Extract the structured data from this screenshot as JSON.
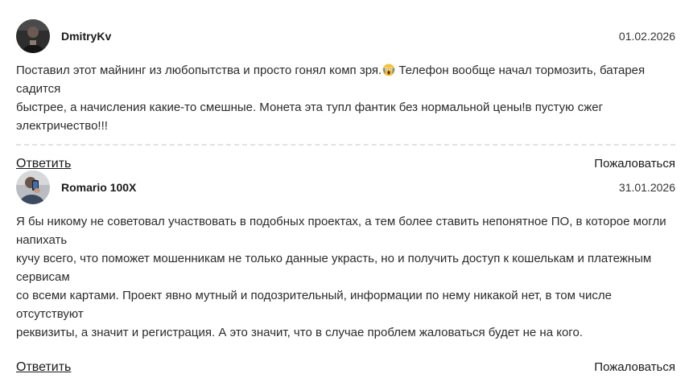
{
  "comments": [
    {
      "author": "DmitryKv",
      "date": "01.02.2026",
      "text_before_emoji": "Поставил этот майнинг из любопытства и просто гонял комп зря.",
      "emoji": "face-screaming-in-fear",
      "text_after_emoji": " Телефон вообще начал тормозить, батарея садится\nбыстрее, а начисления какие-то смешные. Монета эта тупл фантик без нормальной цены!в пустую сжег электричество!!!",
      "reply_label": "Ответить",
      "report_label": "Пожаловаться"
    },
    {
      "author": "Romario 100X",
      "date": "31.01.2026",
      "text": "Я бы никому не советовал участвовать в подобных проектах, а тем более ставить непонятное ПО, в которое могли напихать\nкучу всего, что поможет мошенникам не только данные украсть, но и получить доступ к кошелькам и платежным сервисам\nсо всеми картами. Проект явно мутный и подозрительный, информации по нему никакой нет, в том числе отсутствуют\nреквизиты, а значит и регистрация. А это значит, что в случае проблем жаловаться будет не на кого.",
      "reply_label": "Ответить",
      "report_label": "Пожаловаться"
    }
  ]
}
